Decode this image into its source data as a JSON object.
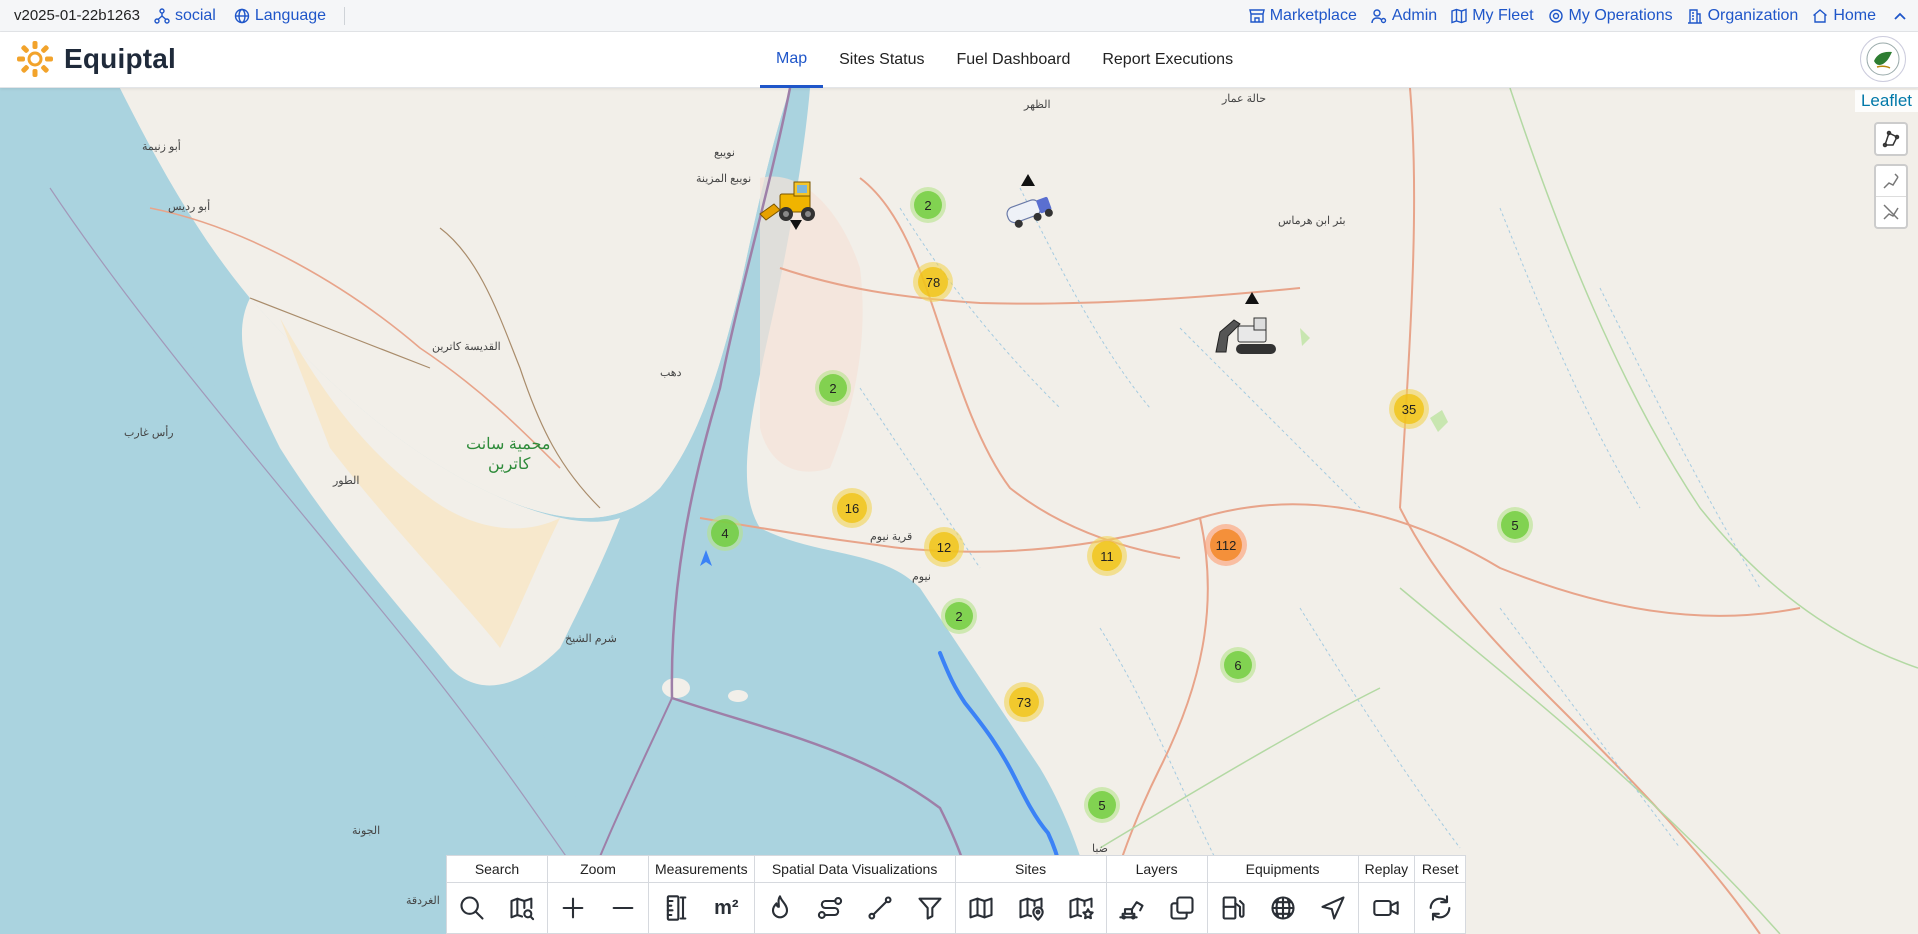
{
  "topbar": {
    "version": "v2025-01-22b1263",
    "left_links": [
      {
        "label": "social",
        "icon": "share-nodes-icon"
      },
      {
        "label": "Language",
        "icon": "globe-icon"
      }
    ],
    "right_links": [
      {
        "label": "Marketplace",
        "icon": "store-icon"
      },
      {
        "label": "Admin",
        "icon": "user-gear-icon"
      },
      {
        "label": "My Fleet",
        "icon": "map-icon"
      },
      {
        "label": "My Operations",
        "icon": "cog-icon"
      },
      {
        "label": "Organization",
        "icon": "building-icon"
      },
      {
        "label": "Home",
        "icon": "home-icon"
      }
    ]
  },
  "header": {
    "brand": "Equiptal",
    "nav": [
      {
        "label": "Map",
        "active": true
      },
      {
        "label": "Sites Status",
        "active": false
      },
      {
        "label": "Fuel Dashboard",
        "active": false
      },
      {
        "label": "Report Executions",
        "active": false
      }
    ]
  },
  "map": {
    "attribution": "Leaflet",
    "labels": {
      "l1": "أبو زنيمة",
      "l2": "أبو رديس",
      "l3": "القديسة كاترين",
      "l4": "رأس غارب",
      "l5": "الطور",
      "l6": "محمية سانت",
      "l7": "كاترين",
      "l8": "دهب",
      "l9": "شرم الشيخ",
      "l10": "الغردقة",
      "l11": "الجونة",
      "l12": "نويبع",
      "l13": "نويبع المزينة",
      "l14": "الظهر",
      "l15": "بئر ابن هرماس",
      "l16": "قرية نيوم",
      "l17": "نيوم",
      "l18": "ضبا",
      "l19": "حالة عمار"
    },
    "clusters": [
      {
        "count": "2",
        "level": "green"
      },
      {
        "count": "78",
        "level": "yellow"
      },
      {
        "count": "2",
        "level": "green"
      },
      {
        "count": "16",
        "level": "yellow"
      },
      {
        "count": "4",
        "level": "green"
      },
      {
        "count": "12",
        "level": "yellow"
      },
      {
        "count": "2",
        "level": "green"
      },
      {
        "count": "11",
        "level": "yellow"
      },
      {
        "count": "112",
        "level": "orange"
      },
      {
        "count": "35",
        "level": "yellow"
      },
      {
        "count": "5",
        "level": "green"
      },
      {
        "count": "6",
        "level": "green"
      },
      {
        "count": "73",
        "level": "yellow"
      },
      {
        "count": "5",
        "level": "green"
      }
    ],
    "vehicles": [
      {
        "type": "wheel-loader-icon"
      },
      {
        "type": "tanker-truck-icon"
      },
      {
        "type": "excavator-icon"
      }
    ]
  },
  "toolbar": {
    "groups": [
      {
        "title": "Search",
        "buttons": [
          "search-icon",
          "map-search-icon"
        ]
      },
      {
        "title": "Zoom",
        "buttons": [
          "zoom-in-icon",
          "zoom-out-icon"
        ]
      },
      {
        "title": "Measurements",
        "buttons": [
          "ruler-icon",
          "area-icon"
        ]
      },
      {
        "title": "Spatial Data Visualizations",
        "buttons": [
          "heatmap-icon",
          "route-icon",
          "line-icon",
          "filter-icon"
        ]
      },
      {
        "title": "Sites",
        "buttons": [
          "map-icon",
          "map-pin-icon",
          "map-star-icon"
        ]
      },
      {
        "title": "Layers",
        "buttons": [
          "excavator-layer-icon",
          "layers-icon"
        ]
      },
      {
        "title": "Equipments",
        "buttons": [
          "fuel-pump-icon",
          "globe-grid-icon",
          "navigation-icon"
        ]
      },
      {
        "title": "Replay",
        "buttons": [
          "video-icon"
        ]
      },
      {
        "title": "Reset",
        "buttons": [
          "refresh-icon"
        ]
      }
    ],
    "area_label": "m²"
  }
}
